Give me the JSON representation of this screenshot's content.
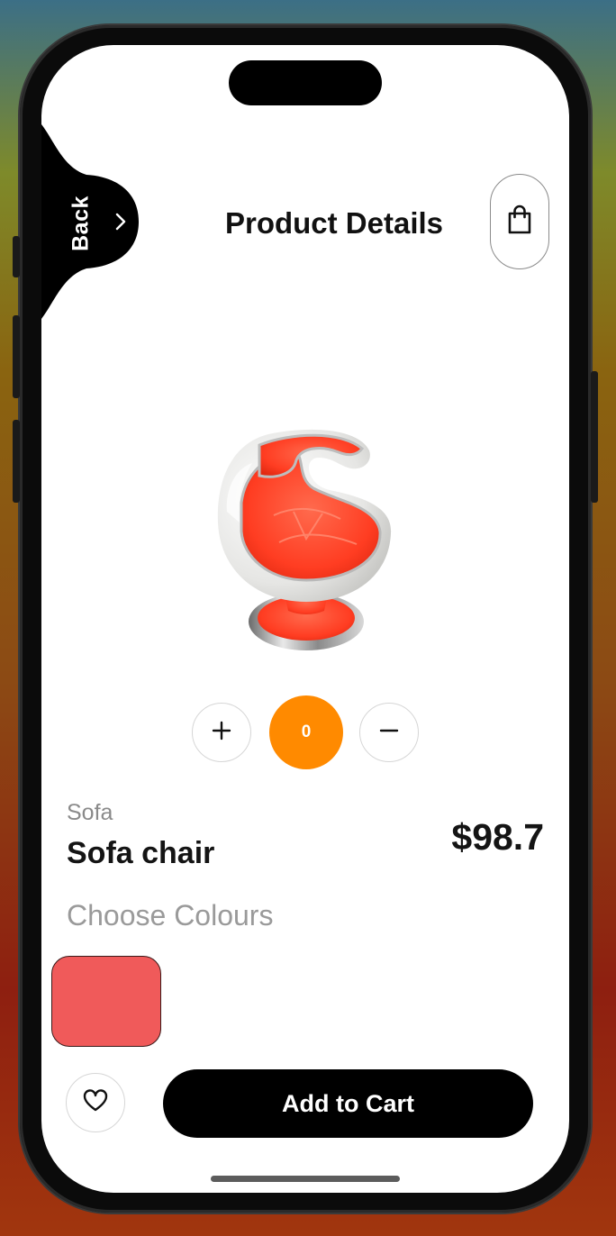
{
  "header": {
    "back_label": "Back",
    "title": "Product Details"
  },
  "icons": {
    "back": "chevron-right-icon",
    "bag": "shopping-bag-icon",
    "plus": "plus-icon",
    "minus": "minus-icon",
    "heart": "heart-icon"
  },
  "product": {
    "image": "sofa-chair-image",
    "quantity": "0",
    "category": "Sofa",
    "name": "Sofa chair",
    "price": "$98.7"
  },
  "colours": {
    "label": "Choose Colours",
    "options": [
      {
        "color": "#f05a5a"
      }
    ]
  },
  "footer": {
    "add_to_cart_label": "Add to Cart"
  },
  "theme": {
    "accent": "#ff8a00",
    "primary": "#000000"
  }
}
